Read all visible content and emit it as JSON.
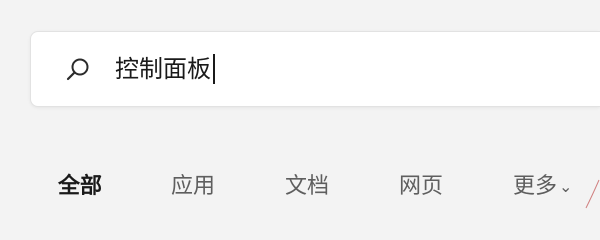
{
  "search": {
    "query": "控制面板",
    "icon": "search-icon"
  },
  "tabs": [
    {
      "label": "全部",
      "active": true
    },
    {
      "label": "应用",
      "active": false
    },
    {
      "label": "文档",
      "active": false
    },
    {
      "label": "网页",
      "active": false
    },
    {
      "label": "更多",
      "active": false
    }
  ],
  "colors": {
    "background": "#f3f3f3",
    "search_box": "#ffffff",
    "text_primary": "#1a1a1a",
    "text_secondary": "#5e5e5e"
  }
}
